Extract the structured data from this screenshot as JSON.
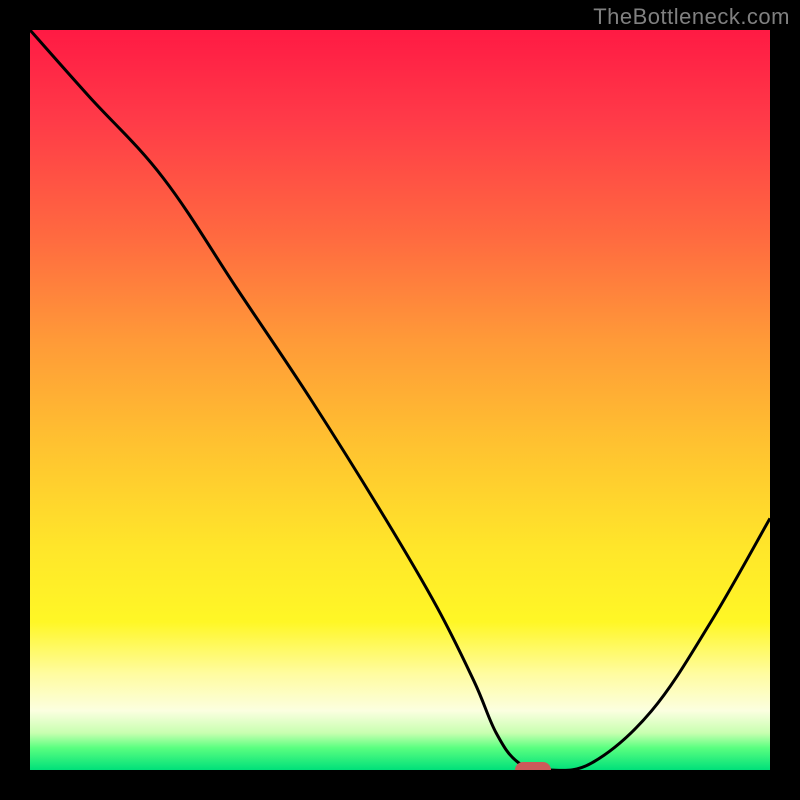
{
  "watermark": "TheBottleneck.com",
  "chart_data": {
    "type": "line",
    "title": "",
    "xlabel": "",
    "ylabel": "",
    "xlim": [
      0,
      100
    ],
    "ylim": [
      0,
      100
    ],
    "grid": false,
    "legend": false,
    "series": [
      {
        "name": "bottleneck-curve",
        "x": [
          0,
          8,
          18,
          28,
          38,
          48,
          55,
          60,
          63,
          66,
          70,
          76,
          84,
          92,
          100
        ],
        "y": [
          100,
          91,
          80,
          65,
          50,
          34,
          22,
          12,
          5,
          1,
          0,
          1,
          8,
          20,
          34
        ]
      }
    ],
    "marker": {
      "x": 68,
      "y": 0,
      "color": "#cc5a5a",
      "shape": "pill"
    },
    "background": "vertical-gradient-red-to-green"
  }
}
